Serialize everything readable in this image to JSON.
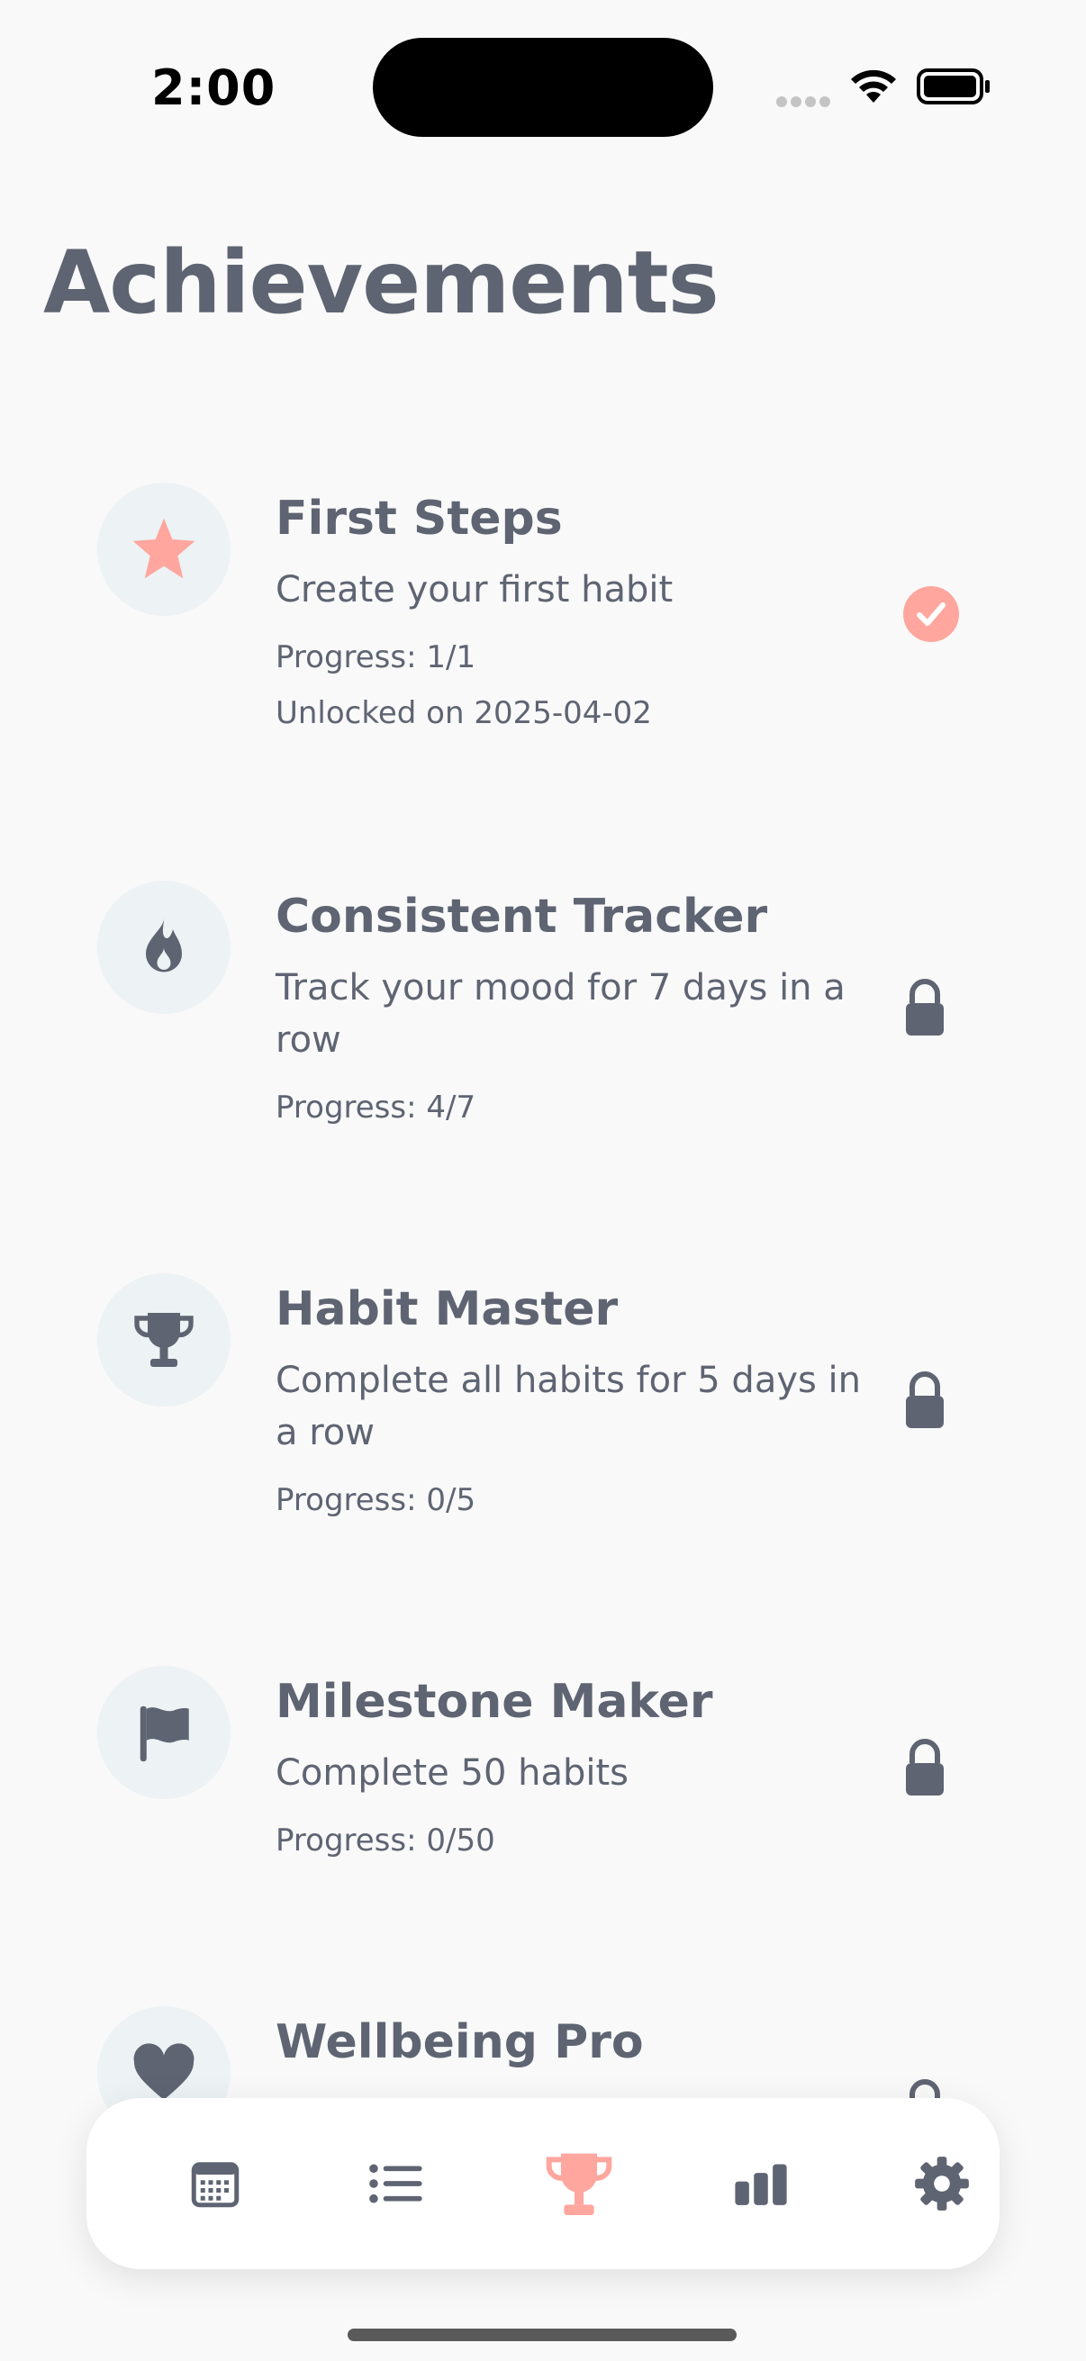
{
  "status_bar": {
    "time": "2:00"
  },
  "title": "Achievements",
  "colors": {
    "accent": "#FFA69E",
    "text": "#5E6472",
    "icon_bg": "#EDF2F4"
  },
  "achievements": [
    {
      "title": "First Steps",
      "description": "Create your first habit",
      "progress": "Progress: 1/1",
      "unlocked": "Unlocked on 2025-04-02",
      "icon": "star-icon",
      "status": "unlocked"
    },
    {
      "title": "Consistent Tracker",
      "description": "Track your mood for 7 days in a row",
      "progress": "Progress: 4/7",
      "icon": "fire-icon",
      "status": "locked"
    },
    {
      "title": "Habit Master",
      "description": "Complete all habits for 5 days in a row",
      "progress": "Progress: 0/5",
      "icon": "trophy-icon",
      "status": "locked"
    },
    {
      "title": "Milestone Maker",
      "description": "Complete 50 habits",
      "progress": "Progress: 0/50",
      "icon": "flag-icon",
      "status": "locked"
    },
    {
      "title": "Wellbeing Pro",
      "icon": "heart-icon",
      "status": "locked"
    }
  ],
  "tab_bar": {
    "tabs": [
      {
        "icon": "calendar-icon",
        "active": false
      },
      {
        "icon": "list-icon",
        "active": false
      },
      {
        "icon": "trophy-icon",
        "active": true
      },
      {
        "icon": "bar-chart-icon",
        "active": false
      },
      {
        "icon": "gear-icon",
        "active": false
      }
    ]
  }
}
